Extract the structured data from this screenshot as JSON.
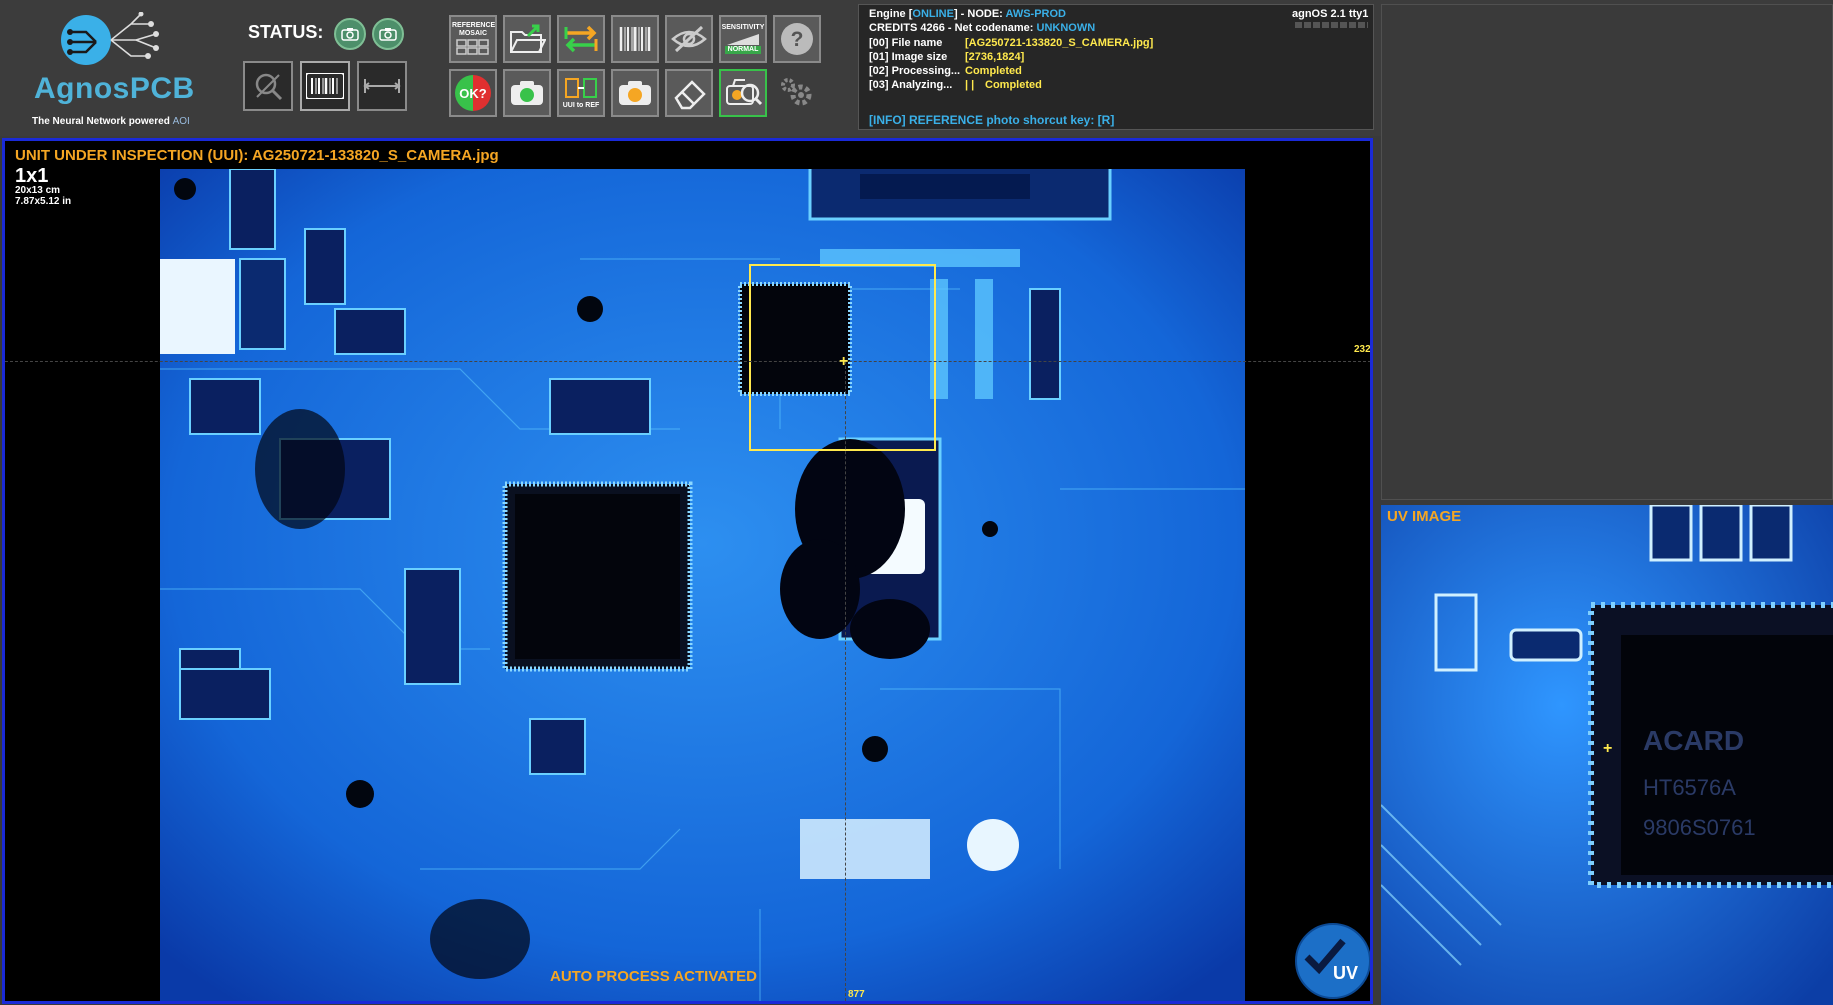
{
  "logo": {
    "brand": "AgnosPCB",
    "tagline": "The Neural Network powered",
    "tagline_suffix": "AOI"
  },
  "status": {
    "label": "STATUS:"
  },
  "toolbar": {
    "reference_mosaic": "REFERENCE MOSAIC",
    "sensitivity": "SENSITIVITY",
    "sensitivity_level": "NORMAL",
    "ok_label": "OK?",
    "uui_to_ref": "UUI to REF"
  },
  "info": {
    "engine_prefix": "Engine [",
    "engine_state": "ONLINE",
    "node_prefix": "] - NODE: ",
    "node": "AWS-PROD",
    "os": "agnOS 2.1 tty1",
    "credits_prefix": "CREDITS 4266 - Net codename: ",
    "codename": "UNKNOWN",
    "file_label": "[00] File name",
    "file_value": "[AG250721-133820_S_CAMERA.jpg]",
    "size_label": "[01] Image size",
    "size_value": "[2736,1824]",
    "proc_label": "[02] Processing...",
    "proc_value": "Completed",
    "analyze_label": "[03] Analyzing...",
    "analyze_bars": "| |",
    "analyze_value": "Completed",
    "shortcut": "[INFO] REFERENCE photo shorcut key: [R]"
  },
  "main": {
    "title": "UNIT UNDER INSPECTION (UUI): AG250721-133820_S_CAMERA.jpg",
    "grid": "1x1",
    "dim_cm": "20x13 cm",
    "dim_in": "7.87x5.12 in",
    "coord_y": "232",
    "coord_x": "877",
    "auto_msg": "AUTO PROCESS ACTIVATED",
    "uv_badge": "UV"
  },
  "uv_panel": {
    "title": "UV IMAGE"
  },
  "colors": {
    "accent_orange": "#f5a623",
    "accent_blue": "#3ab0e8",
    "status_yellow": "#ffe94d",
    "frame_blue": "#1a2ad8"
  }
}
